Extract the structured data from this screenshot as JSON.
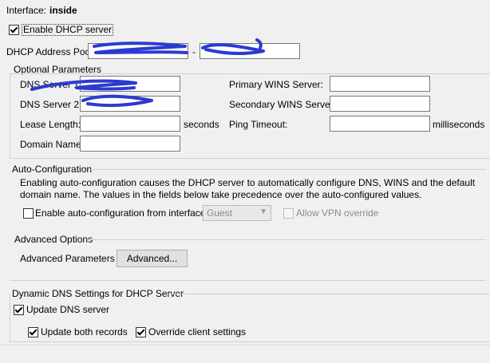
{
  "interface": {
    "label": "Interface:",
    "value": "inside"
  },
  "enable_dhcp": {
    "label": "Enable DHCP server",
    "checked": true
  },
  "pool": {
    "label": "DHCP Address Pool:",
    "start": "",
    "dash": "-",
    "end": ""
  },
  "optional": {
    "title": "Optional Parameters",
    "dns1_label": "DNS Server 1:",
    "dns2_label": "DNS Server 2:",
    "dns1_value": "",
    "dns2_value": "",
    "lease_label": "Lease Length:",
    "lease_unit": "seconds",
    "domain_label": "Domain Name:",
    "primary_wins_label": "Primary WINS Server:",
    "secondary_wins_label": "Secondary WINS Server:",
    "ping_label": "Ping Timeout:",
    "ping_unit": "milliseconds"
  },
  "auto_config": {
    "title": "Auto-Configuration",
    "description": "Enabling auto-configuration causes the DHCP server to automatically configure DNS, WINS and the default domain name. The values in the fields below take precedence over the auto-configured values.",
    "enable_label": "Enable auto-configuration from interface:",
    "interface_select": "Guest",
    "allow_vpn_label": "Allow VPN override"
  },
  "advanced": {
    "title": "Advanced Options",
    "params_label": "Advanced Parameters :",
    "button_label": "Advanced..."
  },
  "ddns": {
    "title": "Dynamic DNS Settings for DHCP Server",
    "update_dns_label": "Update DNS server",
    "update_both_label": "Update both records",
    "override_label": "Override client settings"
  },
  "colors": {
    "redaction": "#2b3bd1",
    "window_bg": "#f0f0f0"
  }
}
